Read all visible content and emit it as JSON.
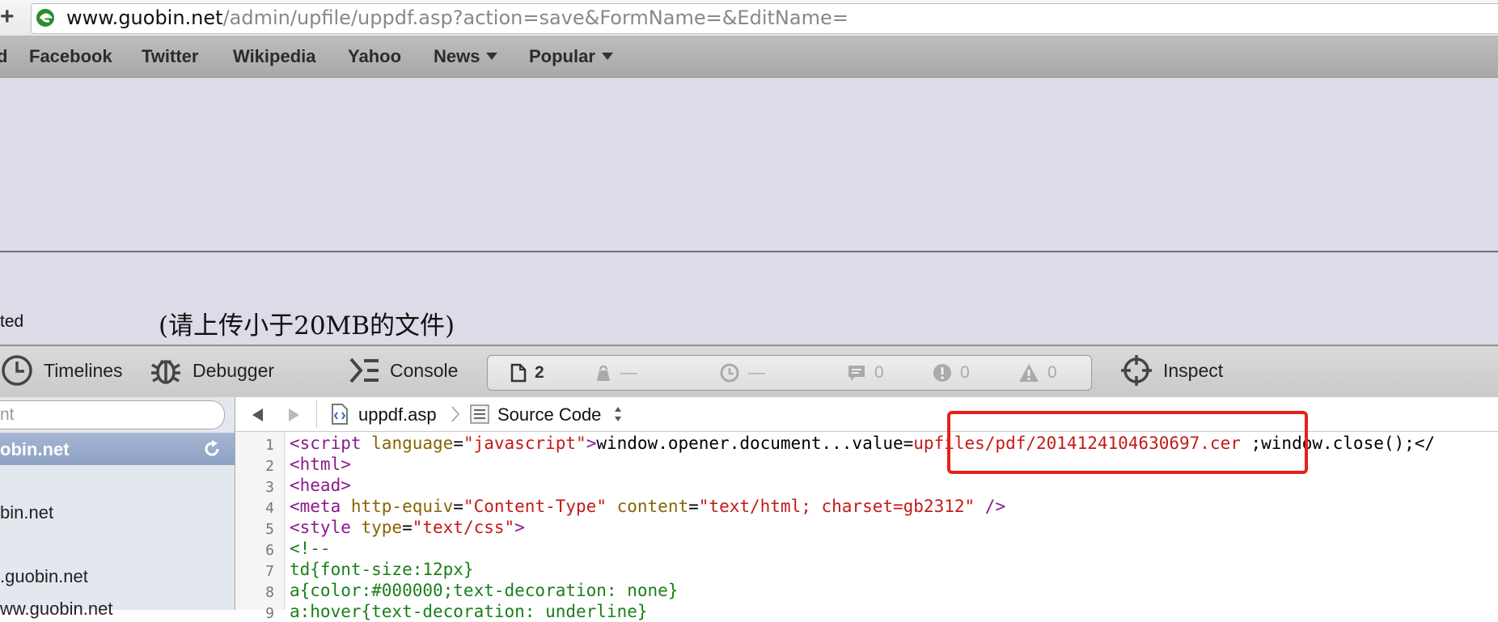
{
  "address_bar": {
    "plus_label": "+",
    "url_host": "www.guobin.net",
    "url_path": "/admin/upfile/uppdf.asp?action=save&FormName=&EditName="
  },
  "bookmarks": {
    "partial_first": "d",
    "items": [
      "Facebook",
      "Twitter",
      "Wikipedia",
      "Yahoo",
      "News",
      "Popular"
    ]
  },
  "page": {
    "left_label": "ted",
    "note": "(请上传小于20MB的文件)"
  },
  "devtools": {
    "tabs": {
      "timelines": "Timelines",
      "debugger": "Debugger",
      "console": "Console",
      "inspect": "Inspect"
    },
    "stats": {
      "resources": "2",
      "size": "—",
      "time": "—",
      "logs": "0",
      "errors": "0",
      "warnings": "0"
    },
    "sidebar": {
      "search_text": "nt",
      "selected": "obin.net",
      "items": [
        "bin.net",
        ".guobin.net",
        "ww.guobin.net"
      ]
    },
    "source_bar": {
      "file": "uppdf.asp",
      "mode": "Source Code"
    },
    "code": {
      "line_numbers": [
        "1",
        "2",
        "3",
        "4",
        "5",
        "6",
        "7",
        "8",
        "9"
      ],
      "l1_tag_open": "<script",
      "l1_attr": " language",
      "l1_eq": "=",
      "l1_str": "\"javascript\"",
      "l1_close": ">",
      "l1_text": "window.opener.document...value=",
      "l1_path": "upfiles/pdf/2014124104630697.cer",
      "l1_rest": " ;window.close();</",
      "l2": "<html>",
      "l3": "<head>",
      "l4_tag": "<meta",
      "l4_attr1": " http-equiv",
      "l4_str1": "\"Content-Type\"",
      "l4_attr2": " content",
      "l4_str2": "\"text/html; charset=gb2312\"",
      "l4_end": " />",
      "l5_tag": "<style",
      "l5_attr": " type",
      "l5_str": "\"text/css\"",
      "l5_end": ">",
      "l6": "<!--",
      "l7": "td{font-size:12px}",
      "l8": "a{color:#000000;text-decoration: none}",
      "l9": "a:hover{text-decoration: underline}"
    }
  }
}
